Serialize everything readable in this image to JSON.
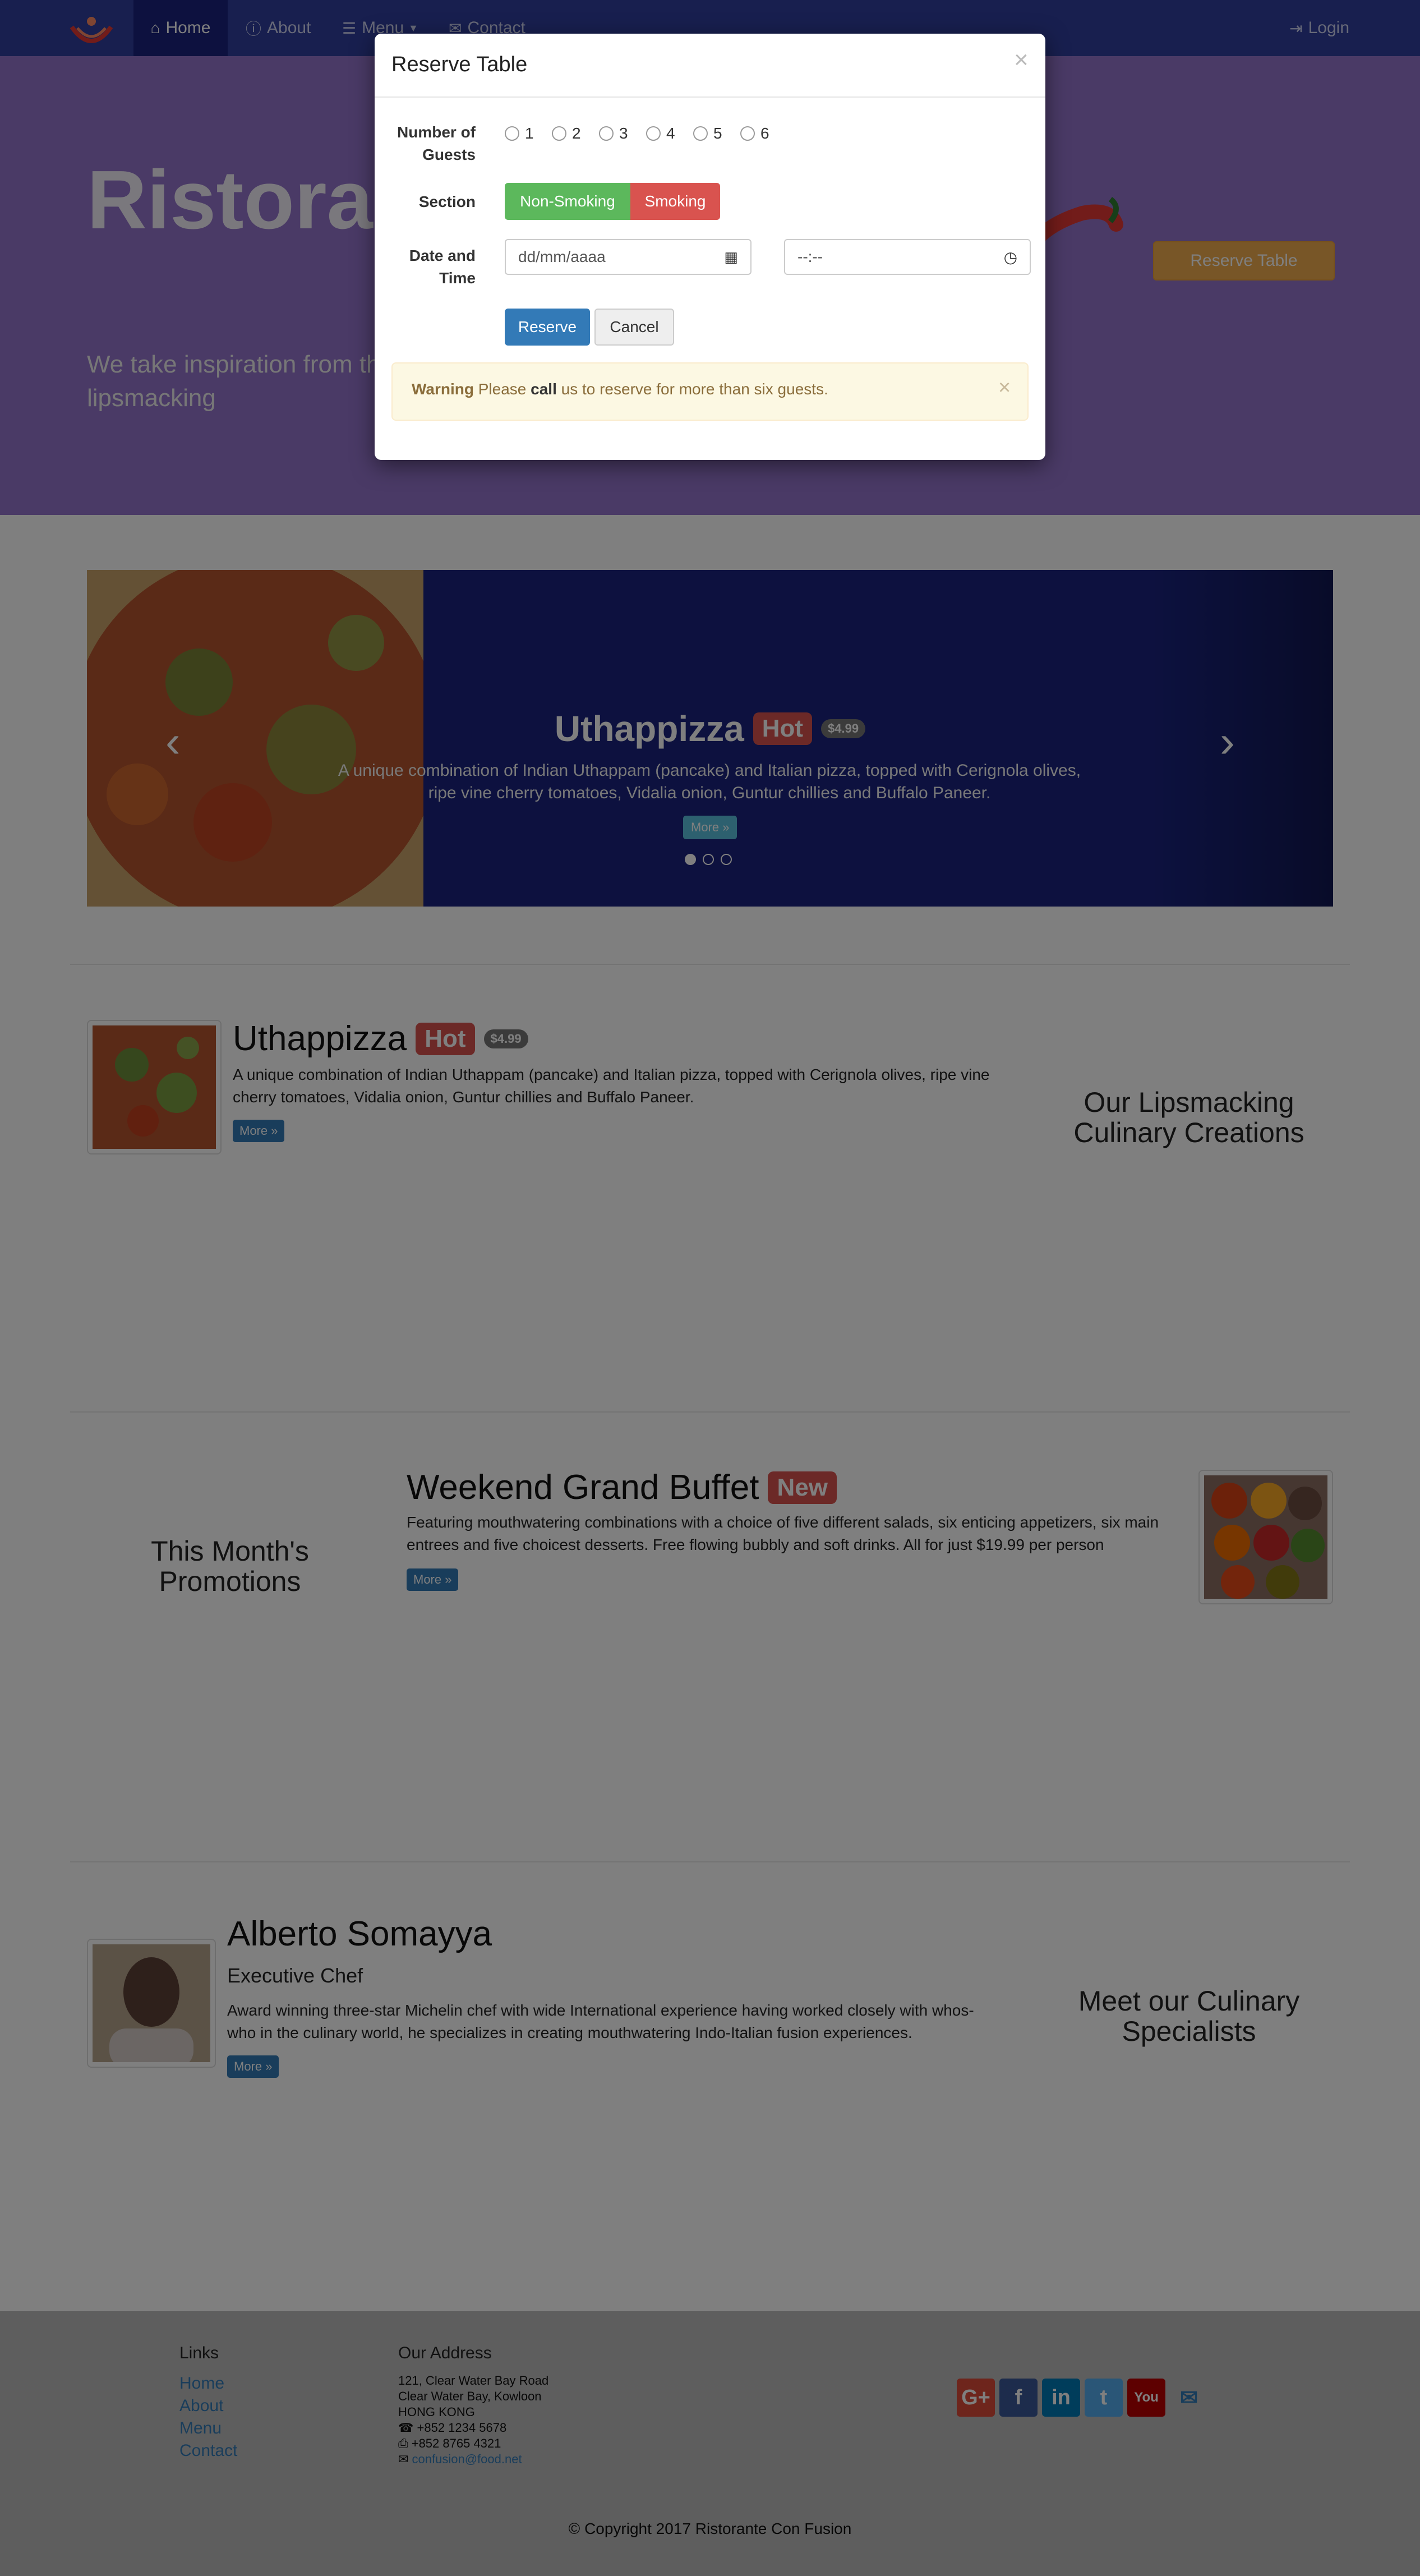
{
  "nav": {
    "home": "Home",
    "about": "About",
    "menu": "Menu",
    "contact": "Contact",
    "login": "Login",
    "colors": {
      "bg": "#303F9F",
      "active": "#1a237e"
    }
  },
  "jumbotron": {
    "name": "Ristorante",
    "tagline": "We take inspiration from the W... experience. Our lipsmacking",
    "reserve": "Reserve Table"
  },
  "carousel": {
    "title": "Uthappizza",
    "badge": "Hot",
    "price": "$4.99",
    "description": "A unique combination of Indian Uthappam (pancake) and Italian pizza, topped with Cerignola olives, ripe vine cherry tomatoes, Vidalia onion, Guntur chillies and Buffalo Paneer.",
    "more": "More »",
    "prev_icon": "chevron-left-icon",
    "next_icon": "chevron-right-icon"
  },
  "dish": {
    "title": "Uthappizza",
    "badge": "Hot",
    "price": "$4.99",
    "description": "A unique combination of Indian Uthappam (pancake) and Italian pizza, topped with Cerignola olives, ripe vine cherry tomatoes, Vidalia onion, Guntur chillies and Buffalo Paneer.",
    "more": "More »",
    "side": "Our Lipsmacking Culinary Creations"
  },
  "promotion": {
    "title": "Weekend Grand Buffet",
    "badge": "New",
    "description": "Featuring mouthwatering combinations with a choice of five different salads, six enticing appetizers, six main entrees and five choicest desserts. Free flowing bubbly and soft drinks. All for just $19.99 per person",
    "more": "More »",
    "side": "This Month's Promotions"
  },
  "leader": {
    "name": "Alberto Somayya",
    "role": "Executive Chef",
    "description": "Award winning three-star Michelin chef with wide International experience having worked closely with whos-who in the culinary world, he specializes in creating mouthwatering Indo-Italian fusion experiences.",
    "more": "More »",
    "side": "Meet our Culinary Specialists"
  },
  "footer": {
    "links_heading": "Links",
    "links": [
      "Home",
      "About",
      "Menu",
      "Contact"
    ],
    "address_heading": "Our Address",
    "address_lines": [
      "121, Clear Water Bay Road",
      "Clear Water Bay, Kowloon",
      "HONG KONG"
    ],
    "phone": "+852 1234 5678",
    "fax": "+852 8765 4321",
    "email": "confusion@food.net",
    "social": [
      "G+",
      "f",
      "in",
      "t",
      "You",
      "✉"
    ],
    "copyright": "© Copyright 2017 Ristorante Con Fusion"
  },
  "modal": {
    "title": "Reserve Table",
    "close": "×",
    "guests_label": "Number of Guests",
    "guests": [
      "1",
      "2",
      "3",
      "4",
      "5",
      "6"
    ],
    "section_label": "Section",
    "nonsmoking": "Non-Smoking",
    "smoking": "Smoking",
    "datetime_label": "Date and Time",
    "date_placeholder": "dd/mm/aaaa",
    "time_placeholder": "--:--",
    "reserve": "Reserve",
    "cancel": "Cancel",
    "warning_strong": "Warning",
    "warning_pre": "Please",
    "warning_call": "call",
    "warning_post": "us to reserve for more than six guests.",
    "warning_close": "×"
  }
}
